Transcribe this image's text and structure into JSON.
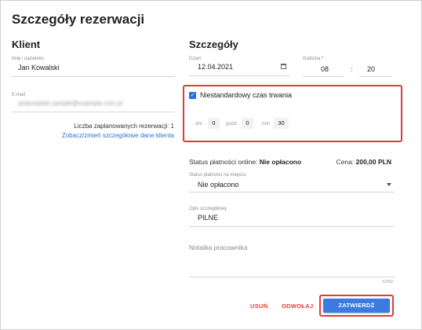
{
  "dialog": {
    "title": "Szczegóły rezerwacji"
  },
  "client": {
    "heading": "Klient",
    "name_label": "Imię i nazwisko",
    "name_value": "Jan Kowalski",
    "email_label": "E-mail",
    "email_value": "jankowalski.sample@example.com.pl",
    "planned_count_text": "Liczba zaplanowanych rezerwacji: 1",
    "details_link": "Zobacz/zmień szczegółowe dane klienta"
  },
  "details": {
    "heading": "Szczegóły",
    "day_label": "Dzień",
    "day_value": "12.04.2021",
    "time_label": "Godzina",
    "time_required_mark": "*",
    "hour_value": "08",
    "time_separator": ":",
    "minute_value": "20",
    "custom_duration_label": "Niestandardowy czas trwania",
    "custom_duration_checked": true,
    "duration": {
      "days_label": "dni",
      "days_value": "0",
      "hours_label": "godz",
      "hours_value": "0",
      "minutes_label": "min",
      "minutes_value": "30"
    },
    "online_payment_label": "Status płatności online:",
    "online_payment_value": "Nie opłacono",
    "price_label": "Cena:",
    "price_value": "200,00 PLN",
    "onsite_payment_label": "Status płatności na miejscu",
    "onsite_payment_value": "Nie opłacono",
    "detailed_desc_label": "Opis szczegółowy",
    "detailed_desc_value": "PILNE",
    "note_placeholder": "Notatka pracownika",
    "note_counter": "0/250"
  },
  "actions": {
    "delete_label": "USUŃ",
    "cancel_label": "ODWOŁAJ",
    "confirm_label": "ZATWIERDŹ"
  },
  "colors": {
    "accent": "#3b7be0",
    "danger": "#e53935",
    "highlight_outline": "#e03a3a"
  }
}
